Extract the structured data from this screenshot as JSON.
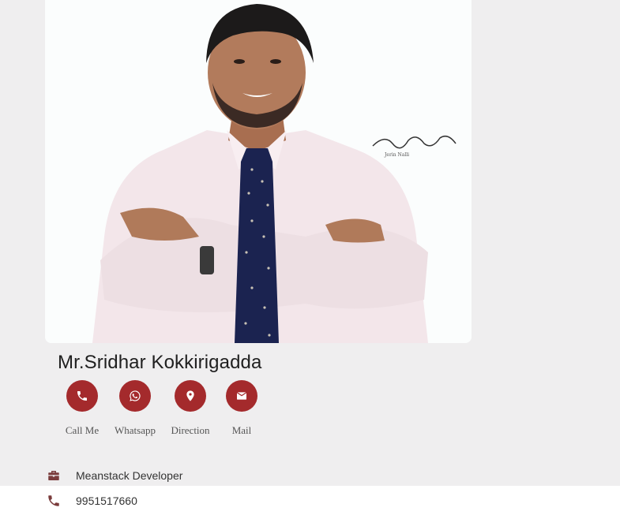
{
  "profile": {
    "name": "Mr.Sridhar Kokkirigadda",
    "photo_signature": "Jerin Nalli"
  },
  "actions": [
    {
      "label": "Call Me",
      "icon": "phone-icon"
    },
    {
      "label": "Whatsapp",
      "icon": "whatsapp-icon"
    },
    {
      "label": "Direction",
      "icon": "map-marker-icon"
    },
    {
      "label": "Mail",
      "icon": "envelope-icon"
    }
  ],
  "details": {
    "job_title": "Meanstack Developer",
    "phone": "9951517660"
  },
  "colors": {
    "accent": "#a42a2c",
    "background": "#efeeef",
    "icon": "#7a3b3b"
  }
}
